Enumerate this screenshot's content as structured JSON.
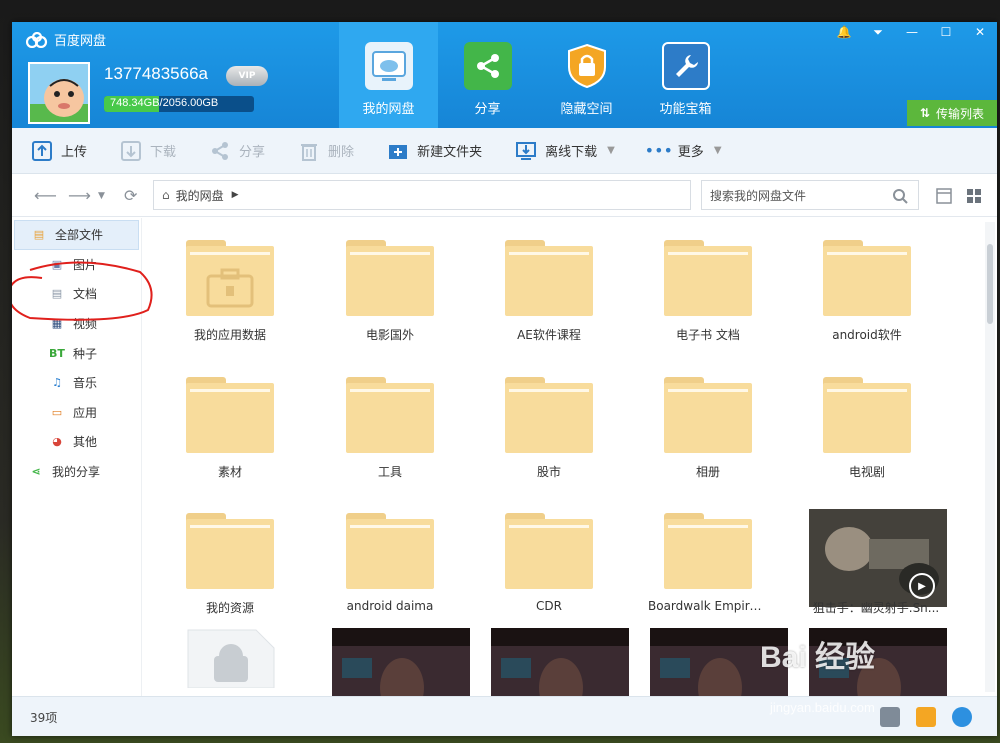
{
  "app": {
    "title": "百度网盘"
  },
  "user": {
    "name": "1377483566a",
    "vip_label": "VIP",
    "quota_text": "748.34GB/2056.00GB",
    "quota_used_fraction": 0.364
  },
  "nav_tabs": [
    {
      "label": "我的网盘",
      "active": true,
      "icon": "cloud-drive-icon"
    },
    {
      "label": "分享",
      "active": false,
      "icon": "share-icon"
    },
    {
      "label": "隐藏空间",
      "active": false,
      "icon": "lock-shield-icon"
    },
    {
      "label": "功能宝箱",
      "active": false,
      "icon": "wrench-icon"
    }
  ],
  "window_controls": {
    "bell": "🔔",
    "menu": "⏷",
    "minimize": "—",
    "maximize": "☐",
    "close": "✕"
  },
  "transfer_list": "传输列表",
  "toolbar": {
    "upload": "上传",
    "download": "下载",
    "share": "分享",
    "delete": "删除",
    "new_folder": "新建文件夹",
    "offline_download": "离线下载",
    "more": "更多"
  },
  "address": {
    "breadcrumb": "我的网盘",
    "search_placeholder": "搜索我的网盘文件"
  },
  "sidebar": {
    "all_files": "全部文件",
    "items": [
      {
        "label": "图片",
        "icon": "image-icon",
        "glyph": "▣",
        "color": "#6b7ea8"
      },
      {
        "label": "文档",
        "icon": "document-icon",
        "glyph": "▤",
        "color": "#8a96a6"
      },
      {
        "label": "视频",
        "icon": "video-icon",
        "glyph": "▦",
        "color": "#2b4b7c"
      },
      {
        "label": "种子",
        "icon": "bt-icon",
        "glyph": "BT",
        "color": "#3aa83a"
      },
      {
        "label": "音乐",
        "icon": "music-icon",
        "glyph": "♫",
        "color": "#2a7fd0"
      },
      {
        "label": "应用",
        "icon": "app-icon",
        "glyph": "▭",
        "color": "#e07a1a"
      },
      {
        "label": "其他",
        "icon": "other-icon",
        "glyph": "◕",
        "color": "#d8453a"
      }
    ],
    "my_share": "我的分享"
  },
  "files": [
    {
      "name": "我的应用数据",
      "kind": "app-folder"
    },
    {
      "name": "电影国外",
      "kind": "folder"
    },
    {
      "name": "AE软件课程",
      "kind": "folder"
    },
    {
      "name": "电子书 文档",
      "kind": "folder"
    },
    {
      "name": "android软件",
      "kind": "folder"
    },
    {
      "name": "素材",
      "kind": "folder"
    },
    {
      "name": "工具",
      "kind": "folder"
    },
    {
      "name": "股市",
      "kind": "folder"
    },
    {
      "name": "相册",
      "kind": "folder"
    },
    {
      "name": "电视剧",
      "kind": "folder"
    },
    {
      "name": "我的资源",
      "kind": "folder"
    },
    {
      "name": "android daima",
      "kind": "folder"
    },
    {
      "name": "CDR",
      "kind": "folder"
    },
    {
      "name": "Boardwalk Empire ...",
      "kind": "folder"
    },
    {
      "name": "狙击手：幽灵射手.Sn...",
      "kind": "video"
    },
    {
      "name": "",
      "kind": "apk"
    },
    {
      "name": "",
      "kind": "video-dark"
    },
    {
      "name": "",
      "kind": "video-dark"
    },
    {
      "name": "",
      "kind": "video-dark"
    },
    {
      "name": "",
      "kind": "video-dark"
    }
  ],
  "status": {
    "count": "39项"
  },
  "watermark": {
    "brand": "Bai  经验",
    "url": "jingyan.baidu.com"
  },
  "colors": {
    "header": "#1685d6",
    "accent_green": "#5cb73c",
    "folder": "#f8dc9c"
  }
}
